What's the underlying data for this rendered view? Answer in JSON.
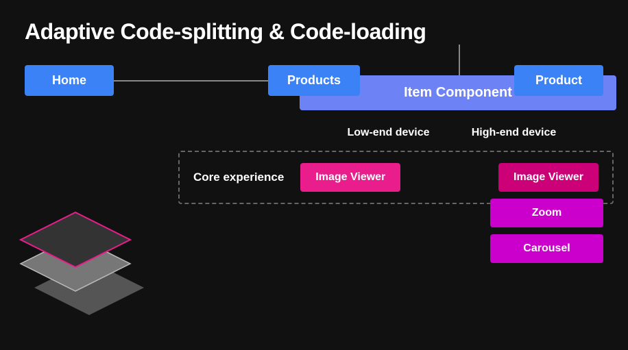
{
  "title": "Adaptive Code-splitting & Code-loading",
  "nodes": {
    "home": "Home",
    "products": "Products",
    "product": "Product",
    "itemComponent": "Item Component"
  },
  "device_labels": {
    "low": "Low-end device",
    "high": "High-end device"
  },
  "core_experience": {
    "label": "Core experience",
    "image_viewer": "Image Viewer"
  },
  "extra_boxes": {
    "zoom": "Zoom",
    "carousel": "Carousel"
  }
}
